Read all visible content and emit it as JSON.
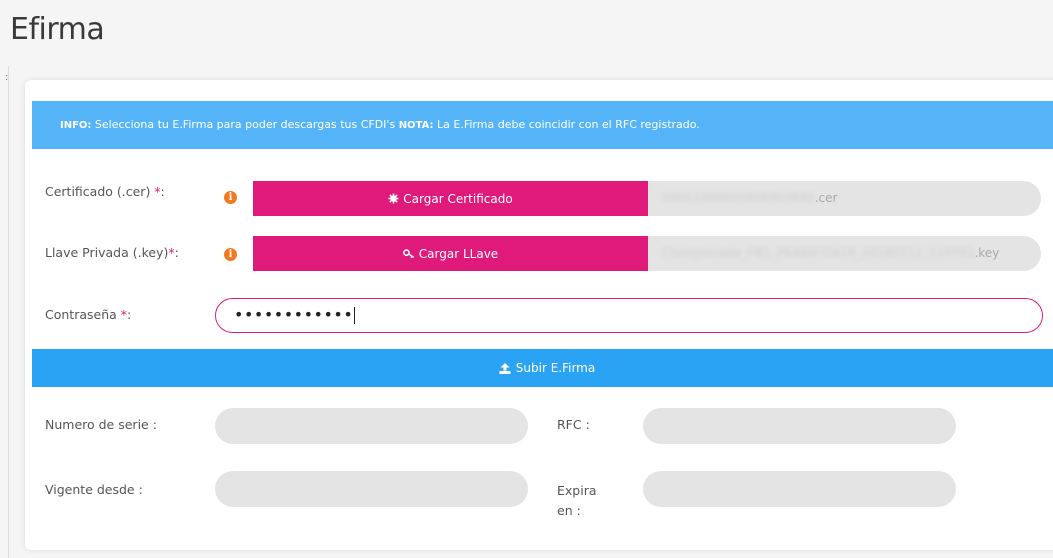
{
  "page": {
    "title": "Efirma",
    "side_marker": ":"
  },
  "info": {
    "info_label": "INFO:",
    "info_text": " Selecciona tu E.Firma para poder descargas tus CFDI's ",
    "nota_label": "NOTA:",
    "nota_text": " La E.Firma debe coincidir con el RFC registrado."
  },
  "form": {
    "cer_label": "Certificado (.cer) ",
    "key_label": "Llave Privada (.key)",
    "password_label": "Contraseña ",
    "required_mark": "*",
    "colon": ":",
    "info_icon_glyph": "i",
    "cer_button": "Cargar Certificado",
    "key_button": "Cargar LLave",
    "cer_file_obscured": "00001000000408903840",
    "cer_file_ext": ".cer",
    "key_file_obscured": "Claveprivada_FIEL_PAAN970418_20180112_110701",
    "key_file_ext": ".key",
    "password_value": "••••••••••••",
    "submit_button": "Subir E.Firma"
  },
  "details": {
    "serial_label": "Numero de serie :",
    "rfc_label": "RFC :",
    "valid_from_label": "Vigente desde :",
    "expires_label_1": "Expira",
    "expires_label_2": "en :",
    "serial_value": "",
    "rfc_value": "",
    "valid_from_value": "",
    "expires_value": ""
  },
  "colors": {
    "info_banner": "#55b4f8",
    "primary_pink": "#e01a7a",
    "submit_blue": "#2ba3f4",
    "info_icon": "#f47721",
    "field_gray": "#e4e4e4"
  },
  "icons": {
    "cer_button_icon": "certificate-icon",
    "key_button_icon": "key-icon",
    "submit_icon": "upload-icon",
    "info_icon": "info-icon"
  }
}
